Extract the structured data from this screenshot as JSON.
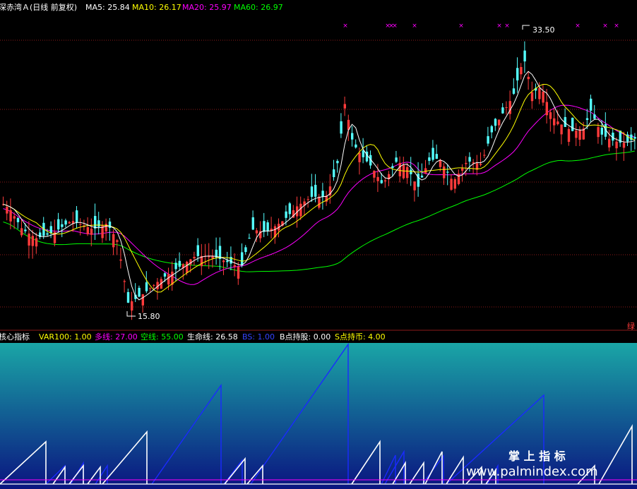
{
  "colors": {
    "background": "#000000",
    "grid": "#8b1a1a",
    "up": "#ff3b3b",
    "down": "#54ffff",
    "ma5": "#ffffff",
    "ma10": "#ffff00",
    "ma20": "#ff00ff",
    "ma60": "#00ff00",
    "sawtooth_white": "#ffffff",
    "sawtooth_blue": "#1a2aff",
    "panel_top": "#1aa6a6",
    "panel_bottom": "#0a1480",
    "baseline": "#ff00ff"
  },
  "header": {
    "name": "深赤湾Ａ(日线 前复权)",
    "ma5": "MA5: 25.84",
    "ma10": "MA10: 26.17",
    "ma20": "MA20: 25.97",
    "ma60": "MA60: 26.97"
  },
  "price_panel": {
    "high_label": "33.50",
    "low_label": "15.80",
    "corner_mark": "绿",
    "marker_symbol": "×"
  },
  "indicator_header": {
    "title": "核心指标",
    "var100": "VAR100: 1.00",
    "duo": "多线: 27.00",
    "kong": "空线: 55.00",
    "sheng": "生命线: 26.58",
    "bs": "BS: 1.00",
    "bpoint": "B点持股: 0.00",
    "spoint": "S点持币: 4.00"
  },
  "watermark": {
    "line1": "掌 上 指 标",
    "line2": "www.palmindex.com"
  },
  "chart_data": {
    "type": "candlestick",
    "ma_lines": [
      "MA5",
      "MA10",
      "MA20",
      "MA60"
    ],
    "ylim": [
      15.0,
      34.5
    ],
    "marked_high": 33.5,
    "marked_low": 15.8,
    "indicator": {
      "name": "核心指标",
      "VAR100": 1.0,
      "多线": 27.0,
      "空线": 55.0,
      "生命线": 26.58,
      "BS": 1.0,
      "B点持股": 0.0,
      "S点持币": 4.0
    }
  }
}
